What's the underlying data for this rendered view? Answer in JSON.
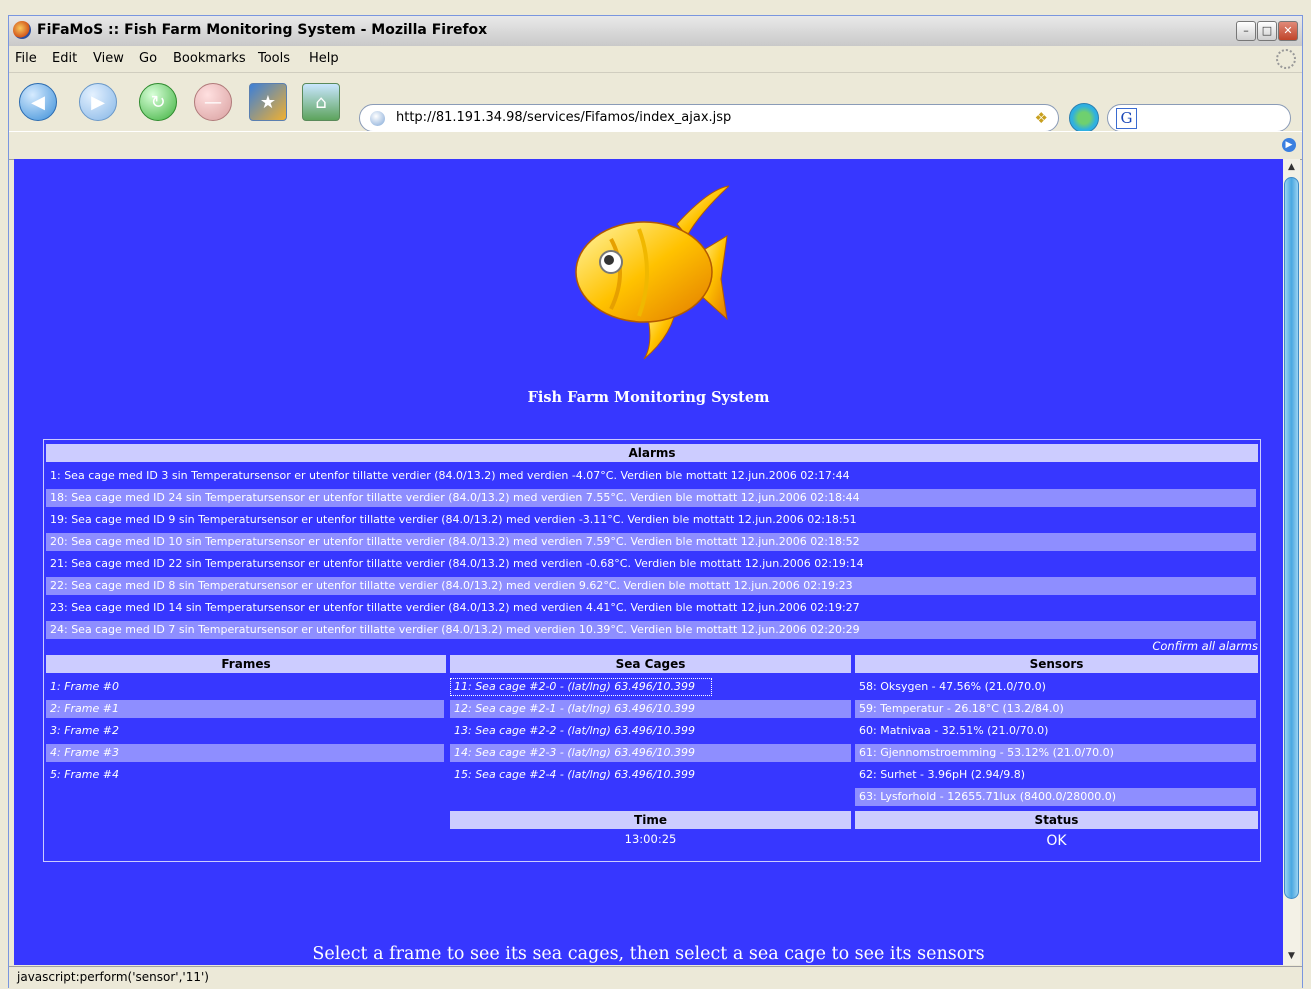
{
  "window": {
    "title": "FiFaMoS :: Fish Farm Monitoring System - Mozilla Firefox"
  },
  "menu": [
    "File",
    "Edit",
    "View",
    "Go",
    "Bookmarks",
    "Tools",
    "Help"
  ],
  "toolbar": {
    "url": "http://81.191.34.98/services/Fifamos/index_ajax.jsp",
    "search_value": ""
  },
  "page": {
    "heading": "Fish Farm Monitoring System",
    "alarms_header": "Alarms",
    "alarms": [
      "1: Sea cage med ID 3 sin Temperatursensor er utenfor tillatte verdier (84.0/13.2) med verdien -4.07°C. Verdien ble mottatt 12.jun.2006 02:17:44",
      "18: Sea cage med ID 24 sin Temperatursensor er utenfor tillatte verdier (84.0/13.2) med verdien 7.55°C. Verdien ble mottatt 12.jun.2006 02:18:44",
      "19: Sea cage med ID 9 sin Temperatursensor er utenfor tillatte verdier (84.0/13.2) med verdien -3.11°C. Verdien ble mottatt 12.jun.2006 02:18:51",
      "20: Sea cage med ID 10 sin Temperatursensor er utenfor tillatte verdier (84.0/13.2) med verdien 7.59°C. Verdien ble mottatt 12.jun.2006 02:18:52",
      "21: Sea cage med ID 22 sin Temperatursensor er utenfor tillatte verdier (84.0/13.2) med verdien -0.68°C. Verdien ble mottatt 12.jun.2006 02:19:14",
      "22: Sea cage med ID 8 sin Temperatursensor er utenfor tillatte verdier (84.0/13.2) med verdien 9.62°C. Verdien ble mottatt 12.jun.2006 02:19:23",
      "23: Sea cage med ID 14 sin Temperatursensor er utenfor tillatte verdier (84.0/13.2) med verdien 4.41°C. Verdien ble mottatt 12.jun.2006 02:19:27",
      "24: Sea cage med ID 7 sin Temperatursensor er utenfor tillatte verdier (84.0/13.2) med verdien 10.39°C. Verdien ble mottatt 12.jun.2006 02:20:29"
    ],
    "confirm_label": "Confirm all alarms",
    "frames_header": "Frames",
    "frames": [
      "1: Frame #0",
      "2: Frame #1",
      "3: Frame #2",
      "4: Frame #3",
      "5: Frame #4"
    ],
    "cages_header": "Sea Cages",
    "cages": [
      "11: Sea cage #2-0 - (lat/lng) 63.496/10.399",
      "12: Sea cage #2-1 - (lat/lng) 63.496/10.399",
      "13: Sea cage #2-2 - (lat/lng) 63.496/10.399",
      "14: Sea cage #2-3 - (lat/lng) 63.496/10.399",
      "15: Sea cage #2-4 - (lat/lng) 63.496/10.399"
    ],
    "sensors_header": "Sensors",
    "sensors": [
      "58: Oksygen - 47.56% (21.0/70.0)",
      "59: Temperatur - 26.18°C (13.2/84.0)",
      "60: Matnivaa - 32.51% (21.0/70.0)",
      "61: Gjennomstroemming - 53.12% (21.0/70.0)",
      "62: Surhet - 3.96pH (2.94/9.8)",
      "63: Lysforhold - 12655.71lux (8400.0/28000.0)"
    ],
    "time_header": "Time",
    "time_value": "13:00:25",
    "status_header": "Status",
    "status_value": "OK",
    "footer": "Select a frame to see its sea cages, then select a sea cage to see its sensors"
  },
  "statusbar": {
    "text": "javascript:perform('sensor','11')"
  },
  "colors": {
    "page_bg": "#3737ff",
    "header_bg": "#ccccff",
    "alt_row": "#8e8eff"
  }
}
